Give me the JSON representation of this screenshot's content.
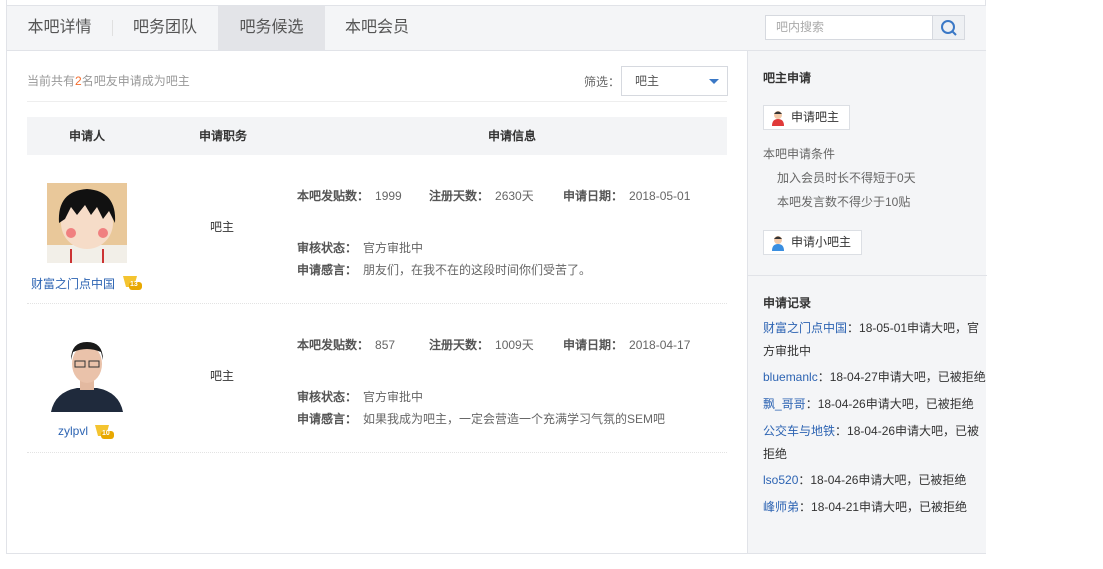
{
  "tabs": [
    {
      "label": "本吧详情"
    },
    {
      "label": "吧务团队"
    },
    {
      "label": "吧务候选"
    },
    {
      "label": "本吧会员"
    }
  ],
  "search": {
    "placeholder": "吧内搜索"
  },
  "summary": {
    "prefix": "当前共有",
    "count": "2",
    "suffix": "名吧友申请成为吧主"
  },
  "filter": {
    "label": "筛选：",
    "value": "吧主"
  },
  "table": {
    "headers": [
      "申请人",
      "申请职务",
      "申请信息"
    ]
  },
  "labels": {
    "posts": "本吧发贴数：",
    "days": "注册天数：",
    "date": "申请日期：",
    "status": "审核状态：",
    "speech": "申请感言："
  },
  "applicants": [
    {
      "name": "财富之门点中国",
      "level": "13",
      "position": "吧主",
      "posts": "1999",
      "days": "2630天",
      "date": "2018-05-01",
      "status": "官方审批中",
      "speech": "朋友们，在我不在的这段时间你们受苦了。"
    },
    {
      "name": "zylpvl",
      "level": "10",
      "position": "吧主",
      "posts": "857",
      "days": "1009天",
      "date": "2018-04-17",
      "status": "官方审批中",
      "speech": "如果我成为吧主，一定会营造一个充满学习气氛的SEM吧"
    }
  ],
  "sidebar": {
    "apply_title": "吧主申请",
    "apply_owner": "申请吧主",
    "cond_title": "本吧申请条件",
    "conds": [
      "加入会员时长不得短于0天",
      "本吧发言数不得少于10贴"
    ],
    "apply_sub": "申请小吧主",
    "records_title": "申请记录",
    "records": [
      {
        "user": "财富之门点中国",
        "text": "：18-05-01申请大吧，官方审批中"
      },
      {
        "user": "bluemanlc",
        "text": "：18-04-27申请大吧，已被拒绝"
      },
      {
        "user": "飘_哥哥",
        "text": "：18-04-26申请大吧，已被拒绝"
      },
      {
        "user": "公交车与地铁",
        "text": "：18-04-26申请大吧，已被拒绝"
      },
      {
        "user": "lso520",
        "text": "：18-04-26申请大吧，已被拒绝"
      },
      {
        "user": "峰师弟",
        "text": "：18-04-21申请大吧，已被拒绝"
      }
    ]
  },
  "colors": {
    "accent": "#2d64b3",
    "highlight": "#f56c2c"
  }
}
